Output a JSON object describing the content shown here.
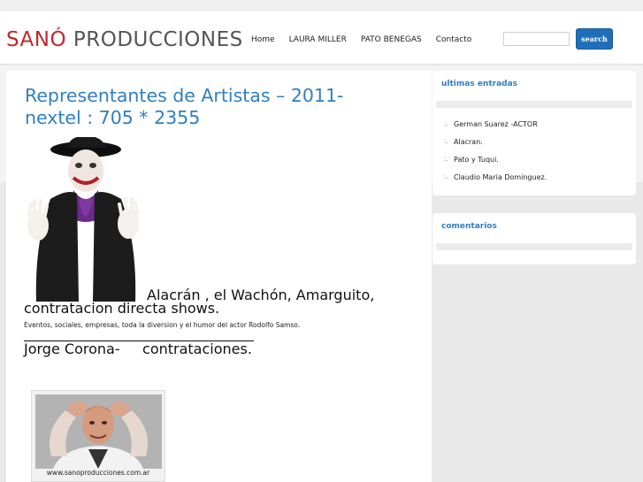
{
  "header": {
    "logo_red": "SANÓ",
    "logo_gray": "PRODUCCIONES",
    "nav": [
      "Home",
      "LAURA MILLER",
      "PATO BENEGAS",
      "Contacto"
    ],
    "search_placeholder": "",
    "search_button": "search"
  },
  "main": {
    "title": "Representantes de Artistas – 2011- nextel : 705 * 2355",
    "line1": "Alacrán , el Wachón, Amarguito,",
    "line2": "contratacion directa shows.",
    "small": "Eventos, sociales, empresas, toda la diversion y el  humor del actor Rodolfo Samso.",
    "line3": "Jorge Corona-     contrataciones.",
    "photo_caption": "www.sanoproducciones.com.ar"
  },
  "sidebar": {
    "box1_title": "ultimas entradas",
    "entries": [
      "German Suarez -ACTOR",
      "Alacran.",
      "Pato y Tuqui.",
      "Claudio Maria Dominguez."
    ],
    "box2_title": "comentarios"
  },
  "colors": {
    "accent_blue": "#2f7fc1",
    "logo_red": "#c1272d",
    "button_blue": "#1f6fb8"
  }
}
